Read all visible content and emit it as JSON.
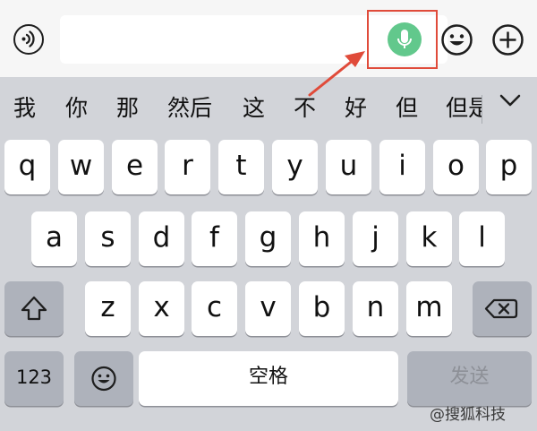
{
  "candidates": [
    "我",
    "你",
    "那",
    "然后",
    "这",
    "不",
    "好",
    "但",
    "但是"
  ],
  "keyboard": {
    "row1": [
      "q",
      "w",
      "e",
      "r",
      "t",
      "y",
      "u",
      "i",
      "o",
      "p"
    ],
    "row2": [
      "a",
      "s",
      "d",
      "f",
      "g",
      "h",
      "j",
      "k",
      "l"
    ],
    "row3": [
      "z",
      "x",
      "c",
      "v",
      "b",
      "n",
      "m"
    ],
    "numbers_label": "123",
    "space_label": "空格",
    "send_label": "发送"
  },
  "watermark": "@搜狐科技",
  "colors": {
    "mic_green": "#62c88c",
    "highlight_red": "#e04b3a",
    "key_bg": "#ffffff",
    "keyboard_bg": "#d2d4d9",
    "function_key_bg": "#aeb2bb"
  },
  "icons": [
    "voice-icon",
    "microphone-icon",
    "emoji-icon",
    "plus-icon",
    "chevron-down-icon",
    "shift-icon",
    "backspace-icon"
  ]
}
